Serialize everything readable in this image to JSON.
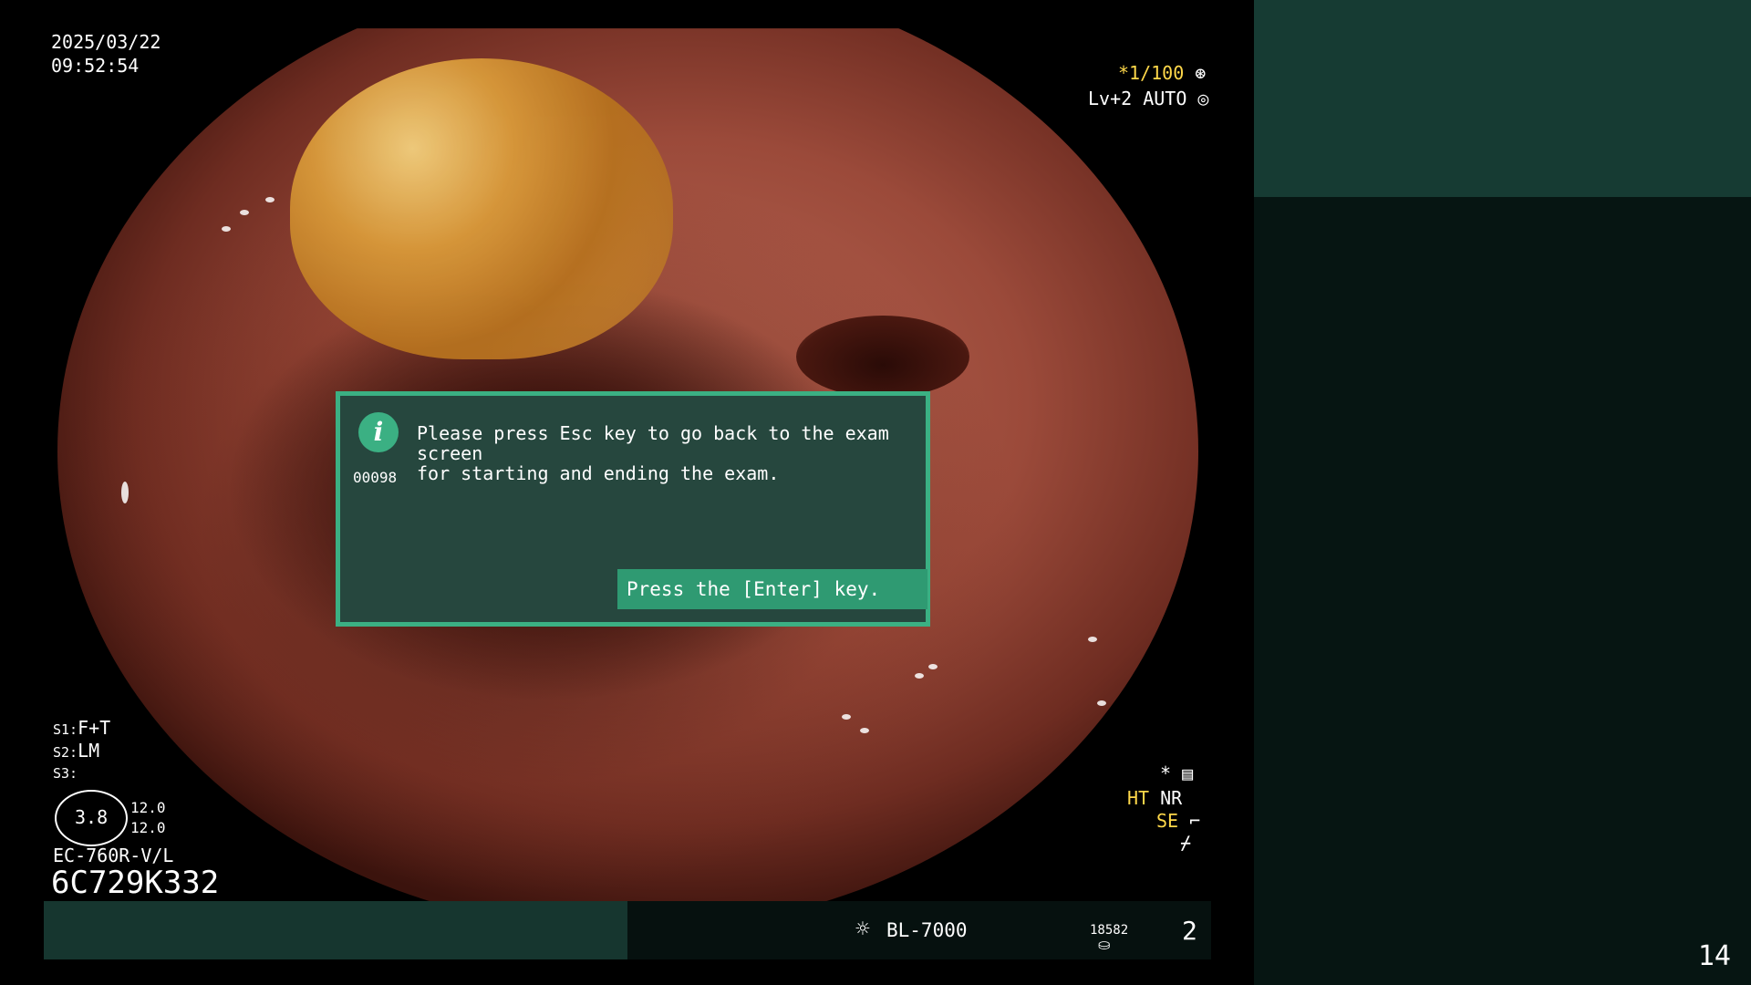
{
  "datetime": {
    "date": "2025/03/22",
    "time": "09:52:54"
  },
  "top_right": {
    "shutter": "*1/100",
    "level_mode": "Lv+2 AUTO"
  },
  "dialog": {
    "message": "Please press Esc key to go back to the exam screen\nfor starting and ending the exam.",
    "code": "00098",
    "enter_label": "Press the [Enter] key."
  },
  "settings": {
    "s1_label": "S1:",
    "s1_value": "F+T",
    "s2_label": "S2:",
    "s2_value": "LM",
    "s3_label": "S3:"
  },
  "gauge": {
    "value": "3.8",
    "val1": "12.0",
    "val2": "12.0"
  },
  "scope": {
    "model": "EC-760R-V/L",
    "serial": "6C729K332"
  },
  "modes": {
    "star": "*",
    "ht": "HT",
    "nr": "NR",
    "se": "SE"
  },
  "bottom": {
    "light_source": "BL-7000",
    "counter": "18582",
    "number": "2"
  },
  "page_number": "14",
  "colors": {
    "dialog_bg": "#26473e",
    "dialog_border": "#3bb083",
    "accent_yellow": "#ffd84a"
  }
}
